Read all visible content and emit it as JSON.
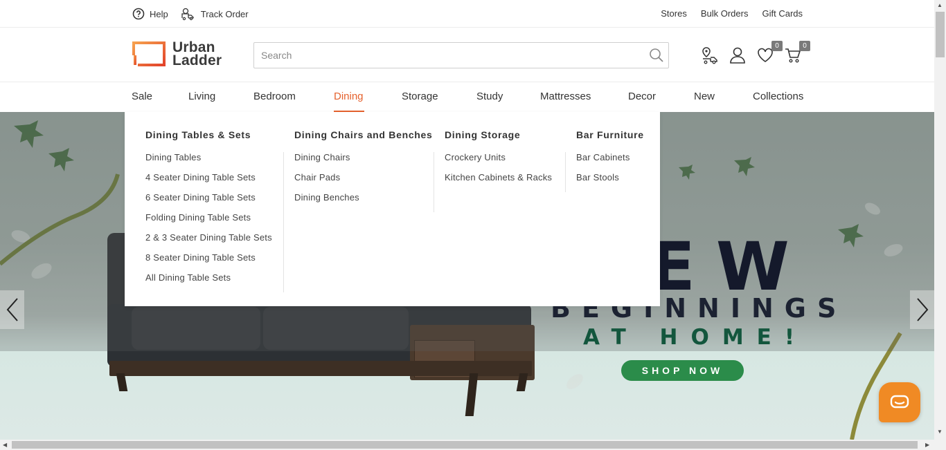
{
  "topbar": {
    "help": "Help",
    "track_order": "Track Order",
    "stores": "Stores",
    "bulk_orders": "Bulk Orders",
    "gift_cards": "Gift Cards"
  },
  "header": {
    "logo_line1": "Urban",
    "logo_line2": "Ladder",
    "search_placeholder": "Search",
    "wishlist_count": "0",
    "cart_count": "0"
  },
  "nav": {
    "items": [
      "Sale",
      "Living",
      "Bedroom",
      "Dining",
      "Storage",
      "Study",
      "Mattresses",
      "Decor",
      "New",
      "Collections"
    ],
    "active": "Dining"
  },
  "dropdown": {
    "columns": [
      {
        "heading": "Dining Tables & Sets",
        "links": [
          "Dining Tables",
          "4 Seater Dining Table Sets",
          "6 Seater Dining Table Sets",
          "Folding Dining Table Sets",
          "2 & 3 Seater Dining Table Sets",
          "8 Seater Dining Table Sets",
          "All Dining Table Sets"
        ]
      },
      {
        "heading": "Dining Chairs and Benches",
        "links": [
          "Dining Chairs",
          "Chair Pads",
          "Dining Benches"
        ]
      },
      {
        "heading": "Dining Storage",
        "links": [
          "Crockery Units",
          "Kitchen Cabinets & Racks"
        ]
      },
      {
        "heading": "Bar Furniture",
        "links": [
          "Bar Cabinets",
          "Bar Stools"
        ]
      }
    ]
  },
  "hero": {
    "title": "NEW",
    "subtitle1": "BEGINNINGS",
    "subtitle2": "AT HOME!",
    "cta": "SHOP NOW"
  },
  "colors": {
    "accent": "#e5612d",
    "cta_green": "#2b8c4a",
    "chat_orange": "#f08a24"
  }
}
